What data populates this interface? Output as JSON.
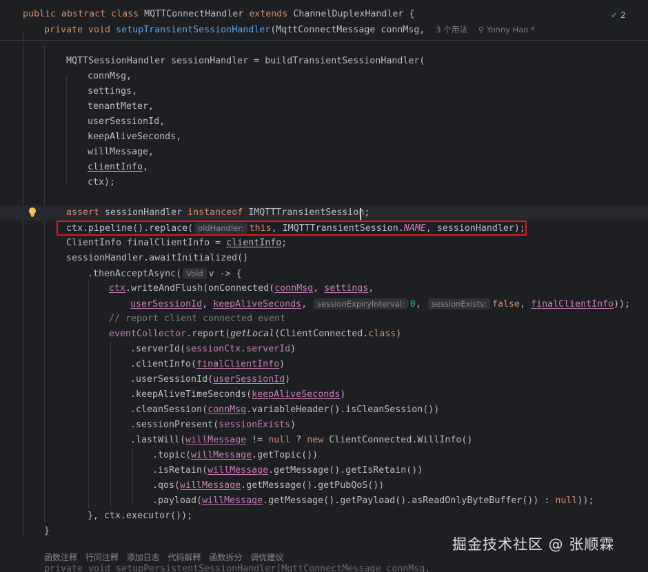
{
  "sticky": {
    "line1": {
      "kw1": "public abstract class ",
      "cls": "MQTTConnectHandler",
      "kw2": " extends ",
      "parent": "ChannelDuplexHandler {"
    },
    "line2": {
      "kw": "private void ",
      "fn": "setupTransientSessionHandler",
      "rest": "(MqttConnectMessage connMsg,",
      "usages": "3 个用法",
      "author": "Yonny Hao *"
    }
  },
  "badge": {
    "count": "2"
  },
  "code": {
    "l1": "MQTTSessionHandler sessionHandler = buildTransientSessionHandler(",
    "l2": "connMsg,",
    "l3": "settings,",
    "l4": "tenantMeter,",
    "l5": "userSessionId,",
    "l6": "keepAliveSeconds,",
    "l7": "willMessage,",
    "l8": "clientInfo",
    "l8b": ",",
    "l9": "ctx);",
    "assert_kw": "assert",
    "assert_mid": " sessionHandler ",
    "assert_kw2": "instanceof",
    "assert_end": " IMQTTTransientSession;",
    "replace_a": "ctx.pipeline().replace(",
    "replace_hint": "oldHandler:",
    "replace_this": "this",
    "replace_b": ", IMQTTTransientSession.",
    "replace_name": "NAME",
    "replace_c": ", sessionHandler);",
    "ci_a": "ClientInfo finalClientInfo = ",
    "ci_b": "clientInfo",
    "ci_c": ";",
    "await": "sessionHandler.awaitInitialized()",
    "then_a": ".thenAcceptAsync(",
    "then_hint": "Void",
    "then_b": "v -> {",
    "w_ctx": "ctx",
    "w_a": ".writeAndFlush(onConnected(",
    "w_connMsg": "connMsg",
    "w_sep": ", ",
    "w_settings": "settings",
    "w_end": ",",
    "u_usid": "userSessionId",
    "u_sep": ", ",
    "u_kas": "keepAliveSeconds",
    "u_hint1": "sessionExpiryInterval:",
    "u_zero": "0",
    "u_hint2": "sessionExists:",
    "u_false": "false",
    "u_fci": "finalClientInfo",
    "u_end": "));",
    "comment": "// report client connected event",
    "ev_a": "eventCollector",
    "ev_b": ".report(",
    "ev_c": "getLocal",
    "ev_d": "(ClientConnected.",
    "ev_class": "class",
    "ev_e": ")",
    "s_a": ".serverId(",
    "s_b": "sessionCtx.serverId",
    "c_a": ".clientInfo(",
    "c_b": "finalClientInfo",
    "us_a": ".userSessionId(",
    "us_b": "userSessionId",
    "ka_a": ".keepAliveTimeSeconds(",
    "ka_b": "keepAliveSeconds",
    "cs_a": ".cleanSession(",
    "cs_b": "connMsg",
    "cs_c": ".variableHeader().isCleanSession())",
    "sp_a": ".sessionPresent(",
    "sp_b": "sessionExists",
    "lw_a": ".lastWill(",
    "lw_b": "willMessage",
    "lw_c": " != ",
    "lw_null": "null",
    "lw_d": " ? ",
    "lw_new": "new",
    "lw_e": " ClientConnected.WillInfo()",
    "tp_a": ".topic(",
    "tp_b": "willMessage",
    "tp_c": ".getTopic())",
    "ir_a": ".isRetain(",
    "ir_b": "willMessage",
    "ir_c": ".getMessage().getIsRetain())",
    "qos_a": ".qos(",
    "qos_b": "willMessage",
    "qos_c": ".getMessage().getPubQoS())",
    "pl_a": ".payload(",
    "pl_b": "willMessage",
    "pl_c": ".getMessage().getPayload().asReadOnlyByteBuffer()) : ",
    "pl_null": "null",
    "pl_d": "));",
    "close1": "}, ctx.executor());",
    "close2": "}"
  },
  "toolbar": {
    "items": [
      "函数注释",
      "行间注释",
      "添加日志",
      "代码解释",
      "函数拆分",
      "调优建议"
    ]
  },
  "next_line": "private void setupPersistentSessionHandler(MqttConnectMessage connMsg,",
  "watermark": "掘金技术社区 @ 张顺霖"
}
